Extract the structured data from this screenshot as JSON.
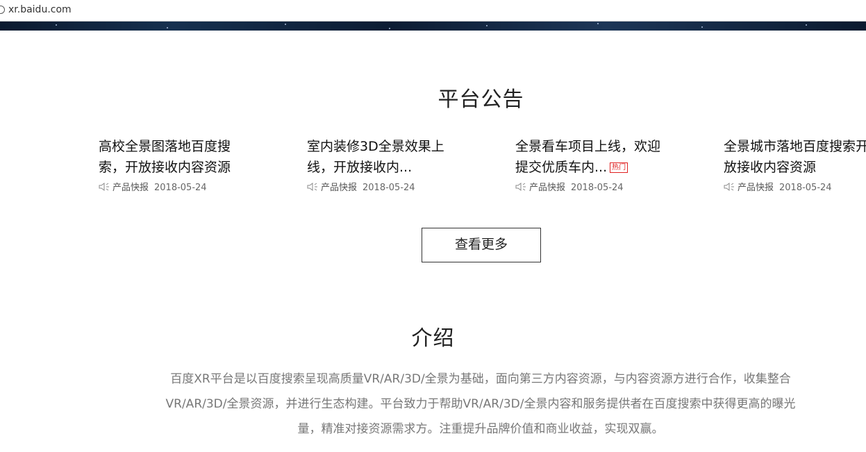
{
  "browser": {
    "url": "xr.baidu.com"
  },
  "announcements": {
    "title": "平台公告",
    "items": [
      {
        "title": "高校全景图落地百度搜索，开放接收内容资源",
        "hot": false,
        "category": "产品快报",
        "date": "2018-05-24"
      },
      {
        "title": "室内装修3D全景效果上线，开放接收内...",
        "hot": false,
        "category": "产品快报",
        "date": "2018-05-24"
      },
      {
        "title": "全景看车项目上线，欢迎提交优质车内...",
        "hot": true,
        "hot_label": "热门",
        "category": "产品快报",
        "date": "2018-05-24"
      },
      {
        "title": "全景城市落地百度搜索开放接收内容资源",
        "hot": false,
        "category": "产品快报",
        "date": "2018-05-24"
      }
    ],
    "more_label": "查看更多"
  },
  "intro": {
    "title": "介绍",
    "text": "百度XR平台是以百度搜索呈现高质量VR/AR/3D/全景为基础，面向第三方内容资源，与内容资源方进行合作，收集整合VR/AR/3D/全景资源，并进行生态构建。平台致力于帮助VR/AR/3D/全景内容和服务提供者在百度搜索中获得更高的曝光量，精准对接资源需求方。注重提升品牌价值和商业收益，实现双赢。"
  },
  "colors": {
    "hot": "#e02020",
    "text": "#222222",
    "muted": "#777777",
    "banner": "#0b1a2f"
  }
}
